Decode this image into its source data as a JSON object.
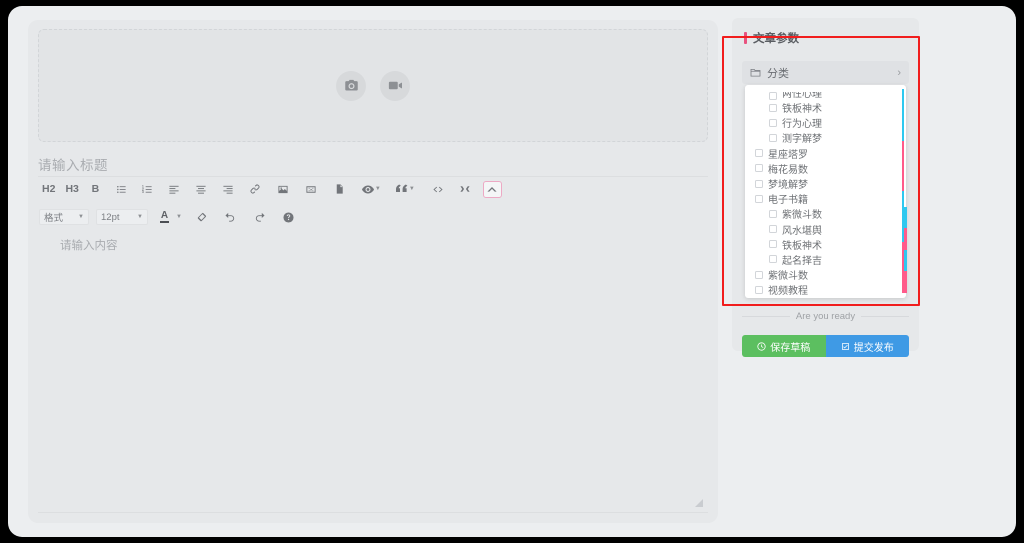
{
  "editor": {
    "cover": {
      "camera_icon": "camera-icon",
      "video_icon": "video-camera-icon"
    },
    "title_placeholder": "请输入标题",
    "content_placeholder": "请输入内容",
    "toolbar": {
      "row1": [
        {
          "name": "heading-2-button",
          "label": "H2",
          "type": "text"
        },
        {
          "name": "heading-3-button",
          "label": "H3",
          "type": "text"
        },
        {
          "name": "bold-button",
          "label": "B",
          "type": "text"
        },
        {
          "name": "unordered-list-button",
          "label": "",
          "type": "ul-icon"
        },
        {
          "name": "ordered-list-button",
          "label": "",
          "type": "ol-icon"
        },
        {
          "name": "align-left-button",
          "label": "",
          "type": "align-left-icon"
        },
        {
          "name": "align-center-button",
          "label": "",
          "type": "align-center-icon"
        },
        {
          "name": "align-right-button",
          "label": "",
          "type": "align-right-icon"
        },
        {
          "name": "link-button",
          "label": "",
          "type": "link-icon"
        },
        {
          "name": "image-button",
          "label": "",
          "type": "image-icon"
        },
        {
          "name": "video-button",
          "label": "",
          "type": "video-icon"
        },
        {
          "name": "file-button",
          "label": "",
          "type": "file-icon"
        },
        {
          "name": "preview-button",
          "label": "",
          "type": "eye-icon",
          "caret": true
        },
        {
          "name": "quote-button",
          "label": "",
          "type": "quote-icon",
          "caret": true
        },
        {
          "name": "source-code-button",
          "label": "",
          "type": "code-icon"
        },
        {
          "name": "clear-format-button",
          "label": "",
          "type": "shuffle-icon"
        },
        {
          "name": "collapse-toolbar-button",
          "label": "",
          "type": "chevron-up-icon",
          "active": true
        }
      ],
      "row2": {
        "format_label": "格式",
        "fontsize_label": "12pt",
        "text_color_label": "A",
        "eraser_icon": "eraser-icon",
        "undo_icon": "undo-icon",
        "redo_icon": "redo-icon",
        "help_icon": "help-icon"
      }
    }
  },
  "side_panel": {
    "title": "文章参数",
    "category_field": {
      "label": "分类",
      "folder_icon": "folder-icon",
      "chevron": "›"
    },
    "dropdown": {
      "items": [
        {
          "label": "两性心理",
          "level": 2,
          "checked": false,
          "clipped": true
        },
        {
          "label": "铁板神术",
          "level": 2,
          "checked": false
        },
        {
          "label": "行为心理",
          "level": 2,
          "checked": false
        },
        {
          "label": "测字解梦",
          "level": 2,
          "checked": false
        },
        {
          "label": "星座塔罗",
          "level": 1,
          "checked": false
        },
        {
          "label": "梅花易数",
          "level": 1,
          "checked": false
        },
        {
          "label": "梦境解梦",
          "level": 1,
          "checked": false
        },
        {
          "label": "电子书籍",
          "level": 1,
          "checked": false
        },
        {
          "label": "紫微斗数",
          "level": 2,
          "checked": false
        },
        {
          "label": "风水堪舆",
          "level": 2,
          "checked": false
        },
        {
          "label": "铁板神术",
          "level": 2,
          "checked": false
        },
        {
          "label": "起名择吉",
          "level": 2,
          "checked": false
        },
        {
          "label": "紫微斗数",
          "level": 1,
          "checked": false
        },
        {
          "label": "视频教程",
          "level": 1,
          "checked": false
        }
      ]
    },
    "divider_text": "Are you ready",
    "actions": {
      "save_label": "保存草稿",
      "save_icon": "clock-icon",
      "publish_label": "提交发布",
      "publish_icon": "check-square-icon"
    }
  },
  "colors": {
    "accent_pink": "#e8527f",
    "save_green": "#5cbf60",
    "publish_blue": "#3f9ae5",
    "annotation_red": "#f11d1d",
    "scroll_cyan": "#2ec8ef",
    "scroll_pink": "#ff5a8a"
  }
}
